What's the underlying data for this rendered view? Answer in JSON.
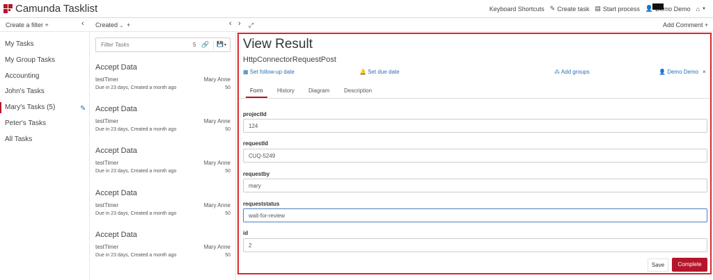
{
  "header": {
    "app_title": "Camunda Tasklist",
    "nav": {
      "shortcuts": "Keyboard Shortcuts",
      "create_task": "Create task",
      "start_process": "Start process",
      "user": "Demo Demo"
    }
  },
  "toolbar": {
    "create_filter": "Create a filter",
    "sort": "Created",
    "add_comment": "Add Comment"
  },
  "filters": [
    {
      "label": "My Tasks"
    },
    {
      "label": "My Group Tasks"
    },
    {
      "label": "Accounting"
    },
    {
      "label": "John's Tasks"
    },
    {
      "label": "Mary's Tasks",
      "count": "(5)"
    },
    {
      "label": "Peter's Tasks"
    },
    {
      "label": "All Tasks"
    }
  ],
  "tasklist": {
    "search_placeholder": "Filter Tasks",
    "count": "5",
    "tasks": [
      {
        "name": "Accept Data",
        "process": "testTimer",
        "assignee": "Mary Anne",
        "due": "Due in 23 days, Created a month ago",
        "priority": "50"
      },
      {
        "name": "Accept Data",
        "process": "testTimer",
        "assignee": "Mary Anne",
        "due": "Due in 23 days, Created a month ago",
        "priority": "50"
      },
      {
        "name": "Accept Data",
        "process": "testTimer",
        "assignee": "Mary Anne",
        "due": "Due in 23 days, Created a month ago",
        "priority": "50"
      },
      {
        "name": "Accept Data",
        "process": "testTimer",
        "assignee": "Mary Anne",
        "due": "Due in 23 days, Created a month ago",
        "priority": "50"
      },
      {
        "name": "Accept Data",
        "process": "testTimer",
        "assignee": "Mary Anne",
        "due": "Due in 23 days, Created a month ago",
        "priority": "50"
      }
    ]
  },
  "detail": {
    "title": "View Result",
    "subtitle": "HttpConnectorRequestPost",
    "actions": {
      "follow_up": "Set follow-up date",
      "due_date": "Set due date",
      "add_groups": "Add groups",
      "assignee": "Demo Demo"
    },
    "tabs": [
      "Form",
      "History",
      "Diagram",
      "Description"
    ],
    "fields": [
      {
        "label": "projectId",
        "value": "124"
      },
      {
        "label": "requestId",
        "value": "CUQ-5249"
      },
      {
        "label": "requestby",
        "value": "mary"
      },
      {
        "label": "requeststatus",
        "value": "wait-for-review"
      },
      {
        "label": "id",
        "value": "2"
      }
    ],
    "buttons": {
      "save": "Save",
      "complete": "Complete"
    }
  },
  "colors": {
    "brand": "#b5152b",
    "link": "#2a6fb5",
    "highlight_border": "#d9262e"
  }
}
